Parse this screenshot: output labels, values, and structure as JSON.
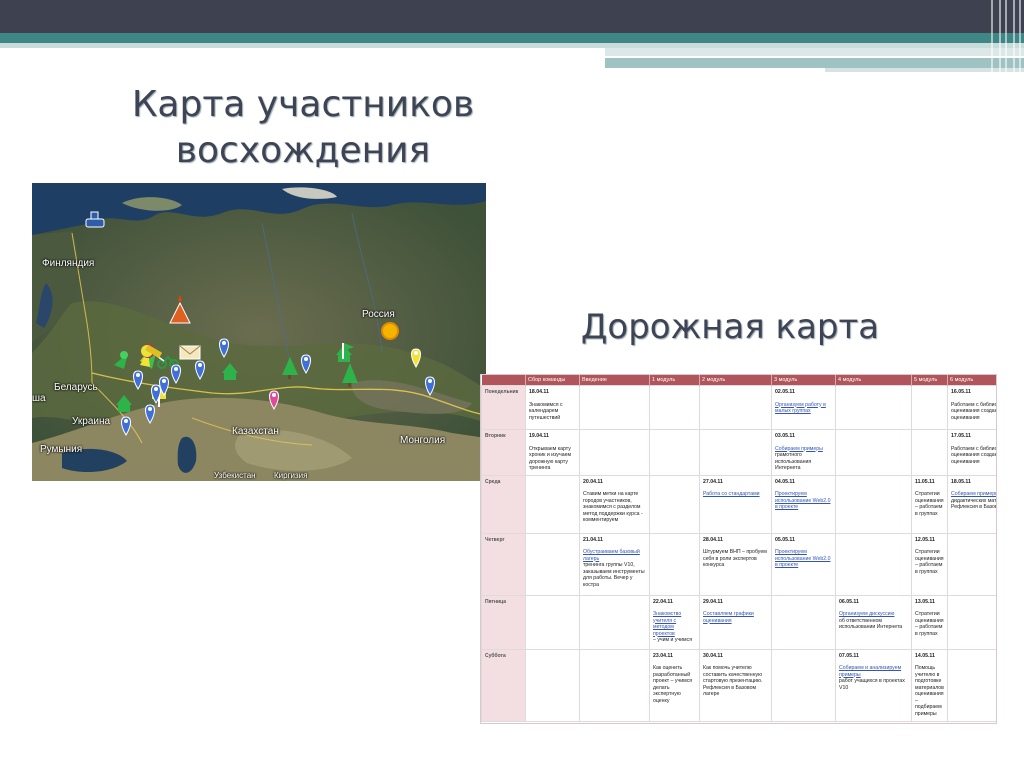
{
  "slide": {
    "title_map": "Карта участников восхождения",
    "title_road": "Дорожная карта"
  },
  "map": {
    "labels": [
      "Финляндия",
      "Россия",
      "Беларусь",
      "Украина",
      "Казахстан",
      "Монголия",
      "Румыния",
      "Узбекистан",
      "Киргизия",
      "ша"
    ]
  },
  "road": {
    "headers": [
      "",
      "Сбор команды",
      "Введение",
      "1 модуль",
      "2 модуль",
      "3 модуль",
      "4 модуль",
      "5 модуль",
      "6 модуль"
    ],
    "rows": [
      {
        "day": "Понедельник",
        "cells": [
          {
            "date": "18.04.11",
            "links": [],
            "text": "Знакомимся с календарем путешествий"
          },
          {},
          {},
          {},
          {
            "date": "02.05.11",
            "links": [
              "Организуем работу в малых группах"
            ],
            "text": ""
          },
          {},
          {},
          {
            "date": "16.05.11",
            "links": [],
            "text": "Работаем с библиотекой оценивания создаем инструменты оценивания"
          }
        ]
      },
      {
        "day": "Вторник",
        "cells": [
          {
            "date": "19.04.11",
            "links": [],
            "text": "Открываем карту хроник и изучаем дорожную карту тренинга"
          },
          {},
          {},
          {},
          {
            "date": "03.05.11",
            "links": [
              "Собираем примеры"
            ],
            "text": "грамотного использования Интернета"
          },
          {},
          {},
          {
            "date": "17.05.11",
            "links": [],
            "text": "Работаем с библиотекой оценивания создаем инструменты оценивания"
          }
        ]
      },
      {
        "day": "Среда",
        "cells": [
          {},
          {
            "date": "20.04.11",
            "links": [],
            "text": "Ставим метки на карте городов участников, знакомимся с разделом метод поддержки курса - комментируем"
          },
          {},
          {
            "date": "27.04.11",
            "links": [
              "Работа со стандартами"
            ],
            "text": ""
          },
          {
            "date": "04.05.11",
            "links": [
              "Проектируем использование Web2.0 в проекте"
            ],
            "text": ""
          },
          {},
          {
            "date": "11.05.11",
            "links": [],
            "text": "Стратегии оценивания – работаем в группах"
          },
          {
            "date": "18.05.11",
            "links": [
              "Собираем примеры"
            ],
            "text": "дидактических материалов Рефлексия в Базовом лагере"
          }
        ]
      },
      {
        "day": "Четверг",
        "cells": [
          {},
          {
            "date": "21.04.11",
            "links": [
              "Обустраиваем базовый лагерь"
            ],
            "text": "тренинга группы V10, заказываем инструменты для работы. Вечер у костра"
          },
          {},
          {
            "date": "28.04.11",
            "links": [],
            "text": "Штурмуем ВНП – пробуем себя в роли экспертов конкурса"
          },
          {
            "date": "05.05.11",
            "links": [
              "Проектируем использование Web2.0 в проекте"
            ],
            "text": ""
          },
          {},
          {
            "date": "12.05.11",
            "links": [],
            "text": "Стратегии оценивания – работаем в группах"
          },
          {}
        ]
      },
      {
        "day": "Пятница",
        "cells": [
          {},
          {},
          {
            "date": "22.04.11",
            "links": [
              "Знакомство учителя с методом проектов"
            ],
            "text": "– учим и учимся"
          },
          {
            "date": "29.04.11",
            "links": [
              "Составляем графики оценивания"
            ],
            "text": ""
          },
          {},
          {
            "date": "06.05.11",
            "links": [
              "Организуем дискуссию"
            ],
            "text": "об ответственном использовании Интернета"
          },
          {
            "date": "13.05.11",
            "links": [],
            "text": "Стратегии оценивания – работаем в группах"
          },
          {}
        ]
      },
      {
        "day": "Суббота",
        "cells": [
          {},
          {},
          {
            "date": "23.04.11",
            "links": [],
            "text": "Как оценить разработанный проект – учимся делать экспертную оценку"
          },
          {
            "date": "30.04.11",
            "links": [],
            "text": "Как помочь учителю составить качественную стартовую презентацию. Рефлексия в Базовом лагере"
          },
          {},
          {
            "date": "07.05.11",
            "links": [
              "Собираем и анализируем примеры"
            ],
            "text": "работ учащихся в проектах V10"
          },
          {
            "date": "14.05.11",
            "links": [],
            "text": "Помощь учителю в подготовке материалов оценивания – подбираем примеры"
          },
          {}
        ]
      }
    ]
  }
}
